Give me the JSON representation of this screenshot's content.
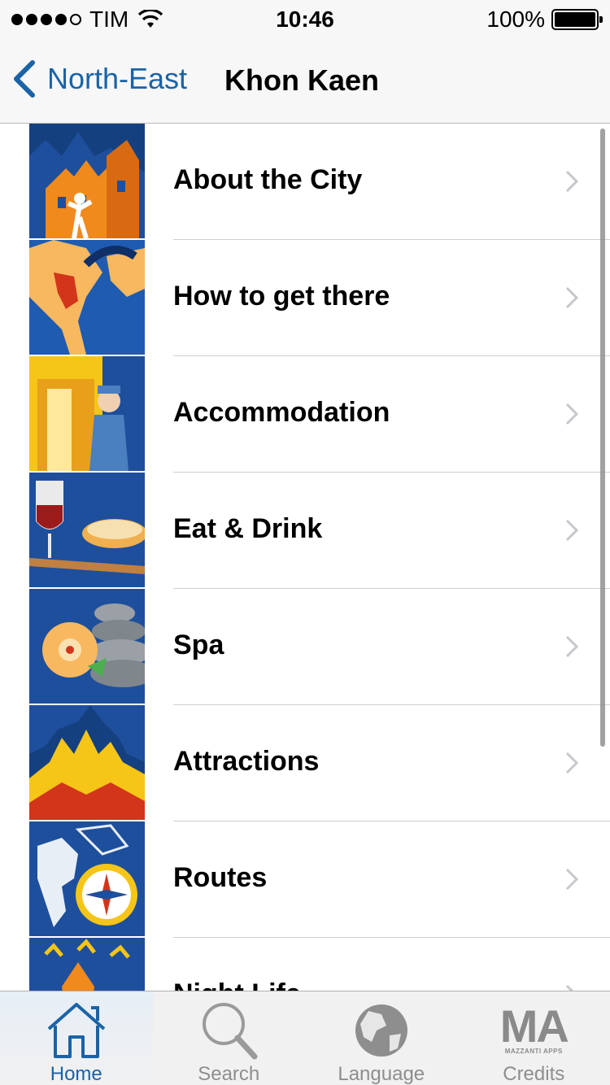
{
  "status_bar": {
    "carrier": "TIM",
    "time": "10:46",
    "battery": "100%",
    "signal_bars": 4
  },
  "nav": {
    "back_label": "North-East",
    "title": "Khon Kaen"
  },
  "menu": {
    "items": [
      {
        "label": "About the City",
        "icon": "city-buildings-icon"
      },
      {
        "label": "How to get there",
        "icon": "map-arrow-icon"
      },
      {
        "label": "Accommodation",
        "icon": "doorman-icon"
      },
      {
        "label": "Eat & Drink",
        "icon": "wine-food-icon"
      },
      {
        "label": "Spa",
        "icon": "spa-stones-flower-icon"
      },
      {
        "label": "Attractions",
        "icon": "temple-icon"
      },
      {
        "label": "Routes",
        "icon": "compass-map-icon"
      },
      {
        "label": "Night Life",
        "icon": "nightlife-icon"
      }
    ]
  },
  "tabs": [
    {
      "label": "Home",
      "icon": "home-icon",
      "active": true
    },
    {
      "label": "Search",
      "icon": "magnifier-icon",
      "active": false
    },
    {
      "label": "Language",
      "icon": "globe-icon",
      "active": false
    },
    {
      "label": "Credits",
      "icon": "mazzanti-apps-logo",
      "active": false
    }
  ],
  "credits_logo": {
    "text": "MA",
    "subtext": "MAZZANTI APPS"
  },
  "colors": {
    "accent": "#1a63a6",
    "thumb_blue": "#1e4f9c",
    "thumb_orange": "#f08a1c",
    "tab_inactive": "#8e8e8e"
  }
}
